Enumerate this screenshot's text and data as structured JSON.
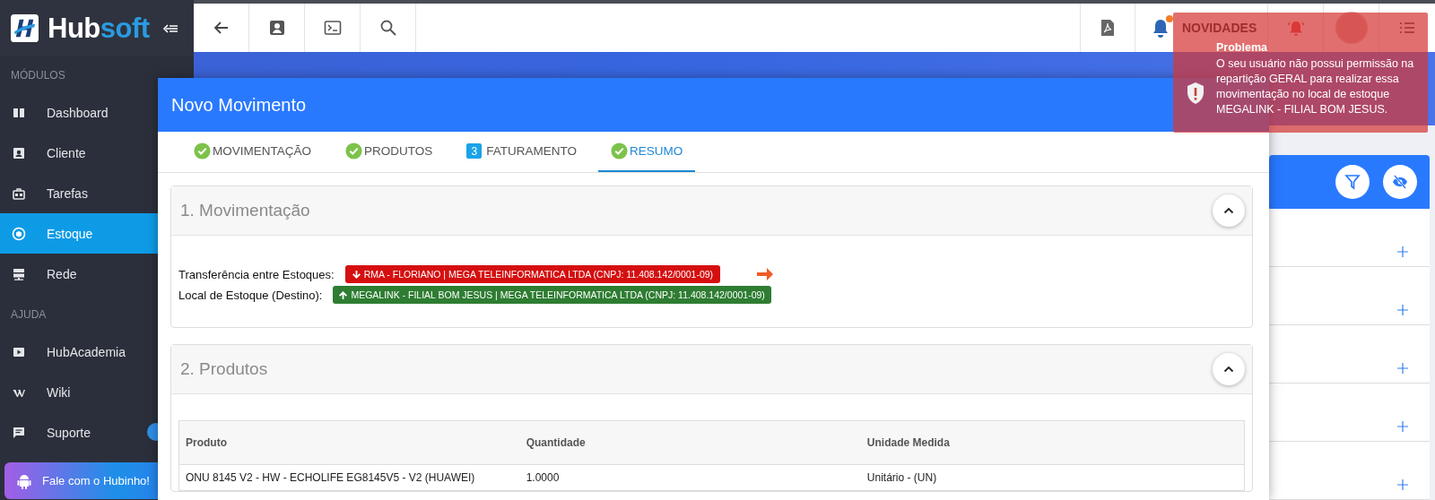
{
  "sidebar": {
    "brand": {
      "part_1": "Hub",
      "part_2": "soft"
    },
    "sections": [
      {
        "title": "MÓDULOS",
        "items": [
          {
            "label": "Dashboard",
            "selected": false
          },
          {
            "label": "Cliente",
            "selected": false
          },
          {
            "label": "Tarefas",
            "selected": false
          },
          {
            "label": "Estoque",
            "selected": true
          },
          {
            "label": "Rede",
            "selected": false
          }
        ]
      },
      {
        "title": "AJUDA",
        "items": [
          {
            "label": "HubAcademia",
            "selected": false
          },
          {
            "label": "Wiki",
            "selected": false
          },
          {
            "label": "Suporte",
            "selected": false
          }
        ]
      }
    ],
    "chat_button": "Fale com o Hubinho!"
  },
  "topbar": {
    "news_label": "NOVIDADES"
  },
  "modal": {
    "title": "Novo Movimento",
    "tabs": [
      {
        "label": "MOVIMENTAÇÃO",
        "kind": "done",
        "selected": false
      },
      {
        "label": "PRODUTOS",
        "kind": "done",
        "selected": false
      },
      {
        "label": "FATURAMENTO",
        "kind": "step",
        "number": "3",
        "selected": false
      },
      {
        "label": "RESUMO",
        "kind": "done",
        "selected": true
      }
    ],
    "movement": {
      "title": "1. Movimentação",
      "transfer_label": "Transferência entre Estoques:",
      "origin": "RMA - FLORIANO | MEGA TELEINFORMATICA LTDA (CNPJ: 11.408.142/0001-09)",
      "destination_label": "Local de Estoque (Destino):",
      "destination": "MEGALINK - FILIAL BOM JESUS | MEGA TELEINFORMATICA LTDA (CNPJ: 11.408.142/0001-09)"
    },
    "products": {
      "title": "2. Produtos",
      "columns": [
        "Produto",
        "Quantidade",
        "Unidade Medida"
      ],
      "rows": [
        [
          "ONU 8145 V2 - HW - ECHOLIFE EG8145V5 - V2 (HUAWEI)",
          "1.0000",
          "Unitário - (UN)"
        ]
      ]
    }
  },
  "toast": {
    "title": "Problema",
    "message": "O seu usuário não possui permissão na repartição GERAL para realizar essa movimentação no local de estoque MEGALINK - FILIAL BOM JESUS."
  }
}
